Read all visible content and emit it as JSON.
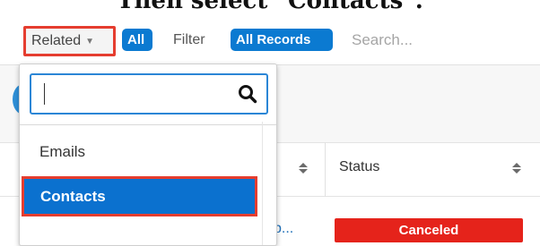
{
  "heading": {
    "text": "Then select \"Contacts\"."
  },
  "toolbar": {
    "related_label": "Related",
    "all_label": "All",
    "filter_label": "Filter",
    "all_records_label": "All Records",
    "search_placeholder": "Search..."
  },
  "table": {
    "status_header": "Status",
    "row": {
      "name_fragment": "b...",
      "status": "Canceled"
    }
  },
  "dropdown": {
    "search_value": "",
    "items": [
      {
        "label": "Emails"
      },
      {
        "label": "Contacts"
      }
    ]
  },
  "colors": {
    "accent_blue": "#0b7ad1",
    "highlight_red": "#e53d2f",
    "status_red": "#e5231b"
  }
}
